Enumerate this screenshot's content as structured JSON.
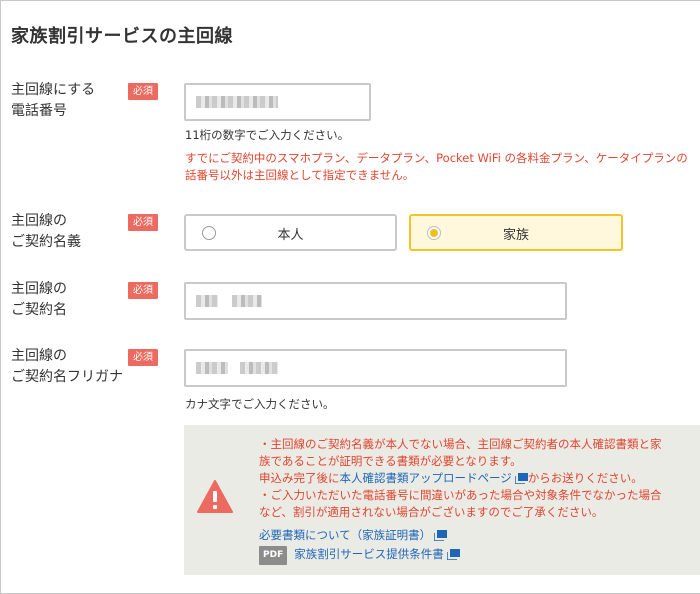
{
  "page": {
    "title": "家族割引サービスの主回線"
  },
  "required_badge": "必須",
  "phone": {
    "label_line1": "主回線にする",
    "label_line2": "電話番号",
    "hint": "11桁の数字でご入力ください。",
    "error_line1": "すでにご契約中のスマホプラン、データプラン、Pocket WiFi の各料金プラン、ケータイプランの",
    "error_line2": "話番号以外は主回線として指定できません。"
  },
  "holder": {
    "label_line1": "主回線の",
    "label_line2": "ご契約名義",
    "options": [
      {
        "label": "本人",
        "selected": false
      },
      {
        "label": "家族",
        "selected": true
      }
    ]
  },
  "name": {
    "label_line1": "主回線の",
    "label_line2": "ご契約名"
  },
  "kana": {
    "label_line1": "主回線の",
    "label_line2": "ご契約名フリガナ",
    "hint": "カナ文字でご入力ください。"
  },
  "notice": {
    "icon": "warning-icon",
    "line1": "・主回線のご契約名義が本人でない場合、主回線ご契約者の本人確認書類と家",
    "line2": "族であることが証明できる書類が必要となります。",
    "line3_pre": "申込み完了後に",
    "line3_link": "本人確認書類アップロードページ",
    "line3_post": "からお送りください。",
    "line4": "・ご入力いただいた電話番号に間違いがあった場合や対象条件でなかった場合",
    "line5": "など、割引が適用されない場合がございますのでご了承ください。",
    "link_docs": "必要書類について（家族証明書）",
    "pdf_badge": "PDF",
    "link_terms": "家族割引サービス提供条件書"
  },
  "colors": {
    "required": "#ec6a5f",
    "error": "#e0452f",
    "link": "#1f66b5",
    "selected_border": "#f1c42c",
    "selected_bg": "#fff8dc",
    "radio_dot": "#f0c020",
    "notice_bg": "#ebebe6",
    "warning_icon": "#ec6a5f"
  }
}
